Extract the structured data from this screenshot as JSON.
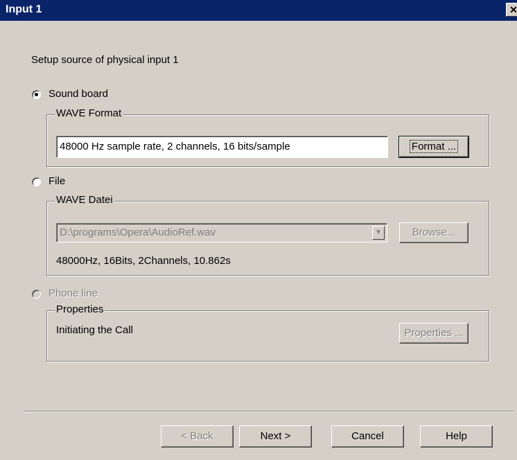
{
  "window": {
    "title": "Input 1",
    "close_glyph": "✕"
  },
  "instruction": "Setup source of physical input 1",
  "sound_board": {
    "radio_label": "Sound board",
    "group_label": "WAVE Format",
    "format_value": "48000 Hz sample rate, 2 channels, 16 bits/sample",
    "format_button": "Format ..."
  },
  "file": {
    "radio_label": "File",
    "group_label": "WAVE Datei",
    "path_value": "D:\\programs\\Opera\\AudioRef.wav",
    "browse_button": "Browse...",
    "info": "48000Hz, 16Bits, 2Channels, 10.862s"
  },
  "phone_line": {
    "radio_label": "Phone line",
    "group_label": "Properties",
    "status": "Initiating the Call",
    "properties_button": "Properties ..."
  },
  "footer": {
    "back_button": "< Back",
    "next_button": "Next >",
    "cancel_button": "Cancel",
    "help_button": "Help"
  }
}
